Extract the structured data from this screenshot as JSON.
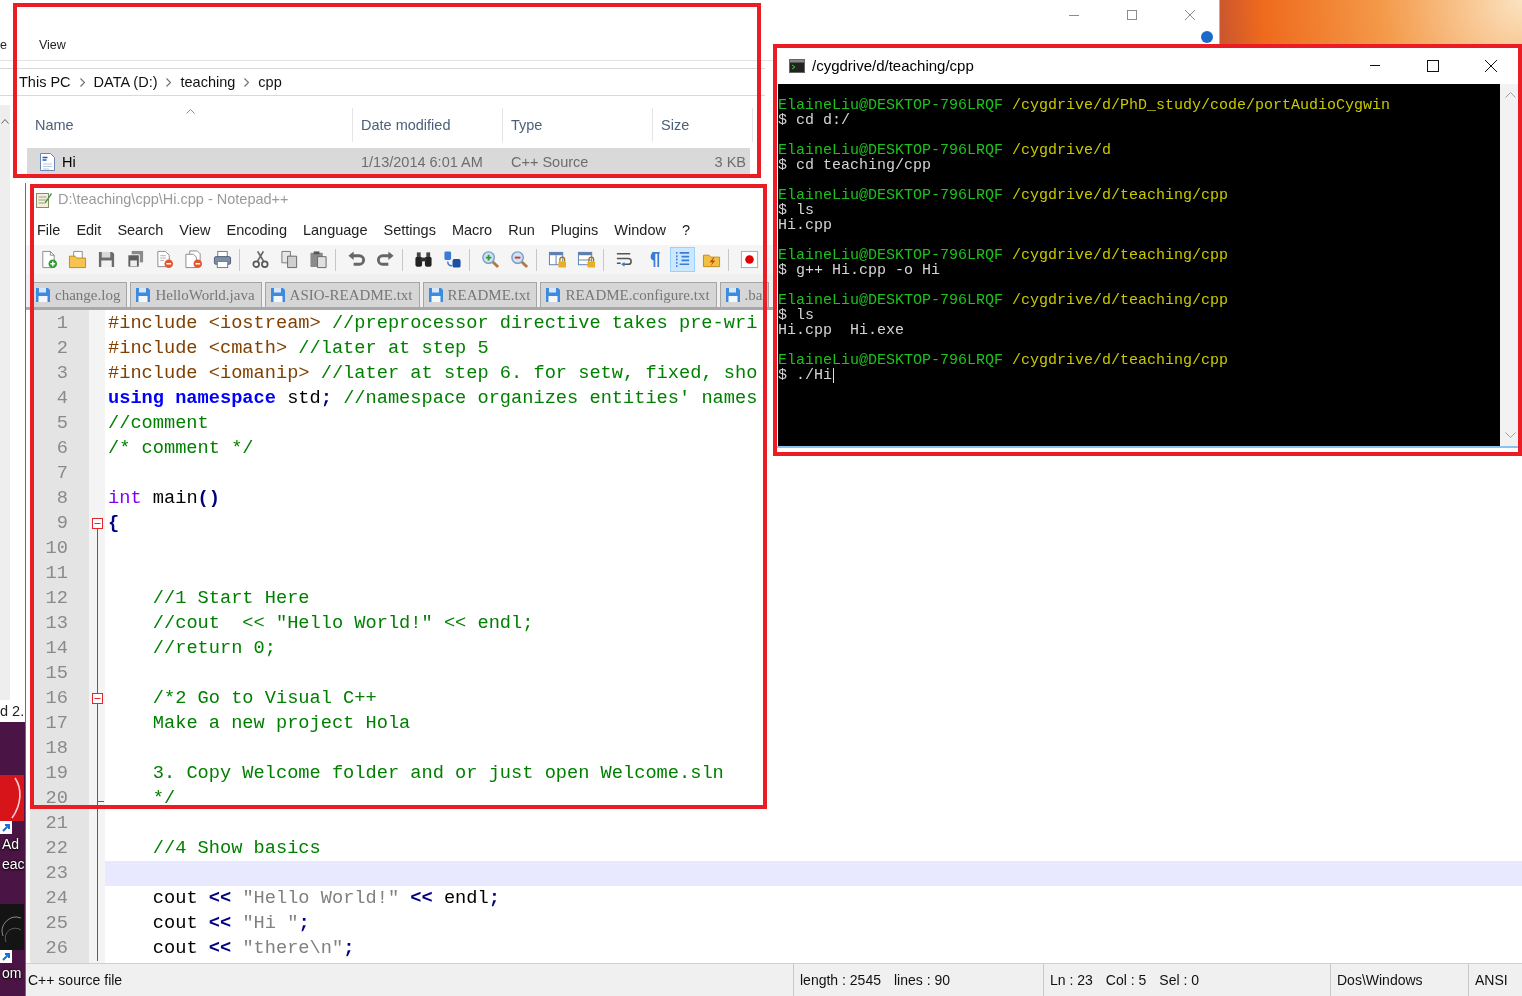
{
  "desktop": {
    "icons": [
      {
        "kind": "reader",
        "label": [
          "Ad",
          "eac"
        ]
      },
      {
        "kind": "prompt",
        "label": [
          "om"
        ]
      }
    ]
  },
  "explorer": {
    "highlighted": true,
    "ribbon_tabs": [
      "e",
      "View"
    ],
    "breadcrumb": [
      "This PC",
      "DATA (D:)",
      "teaching",
      "cpp"
    ],
    "columns": [
      {
        "label": "Name",
        "sorted": true
      },
      {
        "label": "Date modified",
        "sorted": false
      },
      {
        "label": "Type",
        "sorted": false
      },
      {
        "label": "Size",
        "sorted": false
      }
    ],
    "files": [
      {
        "name": "Hi",
        "date_modified": "1/13/2014 6:01 AM",
        "type": "C++ Source",
        "size": "3 KB",
        "selected": true
      }
    ],
    "status_text": "d 2."
  },
  "notepad": {
    "highlighted": true,
    "title": "D:\\teaching\\cpp\\Hi.cpp - Notepad++",
    "menu": [
      "File",
      "Edit",
      "Search",
      "View",
      "Encoding",
      "Language",
      "Settings",
      "Macro",
      "Run",
      "Plugins",
      "Window",
      "?"
    ],
    "toolbar": [
      [
        {
          "kind": "new",
          "pressed": false
        },
        {
          "kind": "open",
          "pressed": false
        },
        {
          "kind": "save",
          "pressed": false
        },
        {
          "kind": "save_all",
          "pressed": false
        },
        {
          "kind": "close",
          "pressed": false
        },
        {
          "kind": "close_all",
          "pressed": false
        },
        {
          "kind": "print",
          "pressed": false
        }
      ],
      [
        {
          "kind": "cut",
          "pressed": false
        },
        {
          "kind": "copy",
          "pressed": false
        },
        {
          "kind": "paste",
          "pressed": false
        }
      ],
      [
        {
          "kind": "undo",
          "pressed": false
        },
        {
          "kind": "redo",
          "pressed": false
        }
      ],
      [
        {
          "kind": "find",
          "pressed": false
        },
        {
          "kind": "replace",
          "pressed": false
        }
      ],
      [
        {
          "kind": "zoom_in",
          "pressed": false
        },
        {
          "kind": "zoom_out",
          "pressed": false
        }
      ],
      [
        {
          "kind": "sync_v",
          "pressed": false
        },
        {
          "kind": "sync_h",
          "pressed": false
        }
      ],
      [
        {
          "kind": "wrap",
          "pressed": false
        },
        {
          "kind": "all_chars",
          "pressed": false
        },
        {
          "kind": "indent_guide",
          "pressed": true
        },
        {
          "kind": "udl",
          "pressed": false
        }
      ],
      [
        {
          "kind": "record",
          "pressed": false
        }
      ]
    ],
    "tabs": [
      {
        "label": "change.log",
        "selected": false
      },
      {
        "label": "HelloWorld.java",
        "selected": false
      },
      {
        "label": "ASIO-README.txt",
        "selected": false
      },
      {
        "label": "README.txt",
        "selected": false
      },
      {
        "label": "README.configure.txt",
        "selected": false
      },
      {
        "label": ".ba",
        "selected": false
      }
    ],
    "lines": [
      {
        "number": "1",
        "kind": "line",
        "current": false,
        "segments": [
          {
            "kind": "preprocessor",
            "text": "#include <iostream>"
          },
          {
            "kind": "comment",
            "text": " //preprocessor directive takes pre-wri"
          }
        ]
      },
      {
        "number": "2",
        "kind": "line",
        "current": false,
        "segments": [
          {
            "kind": "preprocessor",
            "text": "#include <cmath>"
          },
          {
            "kind": "comment",
            "text": " //later at step 5"
          }
        ]
      },
      {
        "number": "3",
        "kind": "line",
        "current": false,
        "segments": [
          {
            "kind": "preprocessor",
            "text": "#include <iomanip>"
          },
          {
            "kind": "comment",
            "text": " //later at step 6. for setw, fixed, sho"
          }
        ]
      },
      {
        "number": "4",
        "kind": "line",
        "current": false,
        "segments": [
          {
            "kind": "keyword",
            "text": "using namespace"
          },
          {
            "kind": "plain",
            "text": " std"
          },
          {
            "kind": "operator",
            "text": ";"
          },
          {
            "kind": "comment",
            "text": " //namespace organizes entities' names"
          }
        ]
      },
      {
        "number": "5",
        "kind": "line",
        "current": false,
        "segments": [
          {
            "kind": "comment",
            "text": "//comment"
          }
        ]
      },
      {
        "number": "6",
        "kind": "line",
        "current": false,
        "segments": [
          {
            "kind": "comment",
            "text": "/* comment */"
          }
        ]
      },
      {
        "number": "7",
        "kind": "line",
        "current": false
      },
      {
        "number": "8",
        "kind": "line",
        "current": false,
        "segments": [
          {
            "kind": "type",
            "text": "int"
          },
          {
            "kind": "plain",
            "text": " main"
          },
          {
            "kind": "operator",
            "text": "()"
          }
        ]
      },
      {
        "number": "9",
        "kind": "foldstart",
        "current": false,
        "segments": [
          {
            "kind": "operator",
            "text": "{"
          }
        ]
      },
      {
        "number": "10",
        "kind": "line",
        "current": false
      },
      {
        "number": "11",
        "kind": "line",
        "current": false
      },
      {
        "number": "12",
        "kind": "line",
        "current": false,
        "segments": [
          {
            "kind": "comment",
            "text": "    //1 Start Here"
          }
        ]
      },
      {
        "number": "13",
        "kind": "line",
        "current": false,
        "segments": [
          {
            "kind": "comment",
            "text": "    //cout  << \"Hello World!\" << endl;"
          }
        ]
      },
      {
        "number": "14",
        "kind": "line",
        "current": false,
        "segments": [
          {
            "kind": "comment",
            "text": "    //return 0;"
          }
        ]
      },
      {
        "number": "15",
        "kind": "line",
        "current": false
      },
      {
        "number": "16",
        "kind": "foldstart",
        "current": false,
        "segments": [
          {
            "kind": "comment",
            "text": "    /*2 Go to Visual C++"
          }
        ]
      },
      {
        "number": "17",
        "kind": "line",
        "current": false,
        "segments": [
          {
            "kind": "comment",
            "text": "    Make a new project Hola"
          }
        ]
      },
      {
        "number": "18",
        "kind": "line",
        "current": false
      },
      {
        "number": "19",
        "kind": "line",
        "current": false,
        "segments": [
          {
            "kind": "comment",
            "text": "    3. Copy Welcome folder and or just open Welcome.sln"
          }
        ]
      },
      {
        "number": "20",
        "kind": "foldend",
        "current": false,
        "segments": [
          {
            "kind": "comment",
            "text": "    */"
          }
        ]
      },
      {
        "number": "21",
        "kind": "line",
        "current": false
      },
      {
        "number": "22",
        "kind": "line",
        "current": false,
        "segments": [
          {
            "kind": "comment",
            "text": "    //4 Show basics"
          }
        ]
      },
      {
        "number": "23",
        "kind": "line",
        "current": true
      },
      {
        "number": "24",
        "kind": "line",
        "current": false,
        "segments": [
          {
            "kind": "plain",
            "text": "    cout "
          },
          {
            "kind": "operator",
            "text": "<<"
          },
          {
            "kind": "string",
            "text": " \"Hello World!\""
          },
          {
            "kind": "operator",
            "text": " <<"
          },
          {
            "kind": "plain",
            "text": " endl"
          },
          {
            "kind": "operator",
            "text": ";"
          }
        ]
      },
      {
        "number": "25",
        "kind": "line",
        "current": false,
        "segments": [
          {
            "kind": "plain",
            "text": "    cout "
          },
          {
            "kind": "operator",
            "text": "<<"
          },
          {
            "kind": "string",
            "text": " \"Hi \""
          },
          {
            "kind": "operator",
            "text": ";"
          }
        ]
      },
      {
        "number": "26",
        "kind": "line",
        "current": false,
        "segments": [
          {
            "kind": "plain",
            "text": "    cout "
          },
          {
            "kind": "operator",
            "text": "<<"
          },
          {
            "kind": "string",
            "text": " \"there\\n\""
          },
          {
            "kind": "operator",
            "text": ";"
          }
        ]
      }
    ],
    "status": {
      "file_type": "C++ source file",
      "length": "length : 2545",
      "line_count": "lines : 90",
      "ln": "Ln : 23",
      "col": "Col : 5",
      "sel": "Sel : 0",
      "eol": "Dos\\Windows",
      "encoding": "ANSI"
    }
  },
  "terminal": {
    "highlighted": true,
    "title": "/cygdrive/d/teaching/cpp",
    "sessions": [
      {
        "user": "ElaineLiu@DESKTOP-796LRQF",
        "path": "/cygdrive/d/PhD_study/code/portAudioCygwin",
        "command": "$ cd d:/",
        "cursor": false
      },
      {
        "user": "ElaineLiu@DESKTOP-796LRQF",
        "path": "/cygdrive/d",
        "command": "$ cd teaching/cpp",
        "cursor": false
      },
      {
        "user": "ElaineLiu@DESKTOP-796LRQF",
        "path": "/cygdrive/d/teaching/cpp",
        "command": "$ ls",
        "output": "Hi.cpp",
        "cursor": false
      },
      {
        "user": "ElaineLiu@DESKTOP-796LRQF",
        "path": "/cygdrive/d/teaching/cpp",
        "command": "$ g++ Hi.cpp -o Hi",
        "cursor": false
      },
      {
        "user": "ElaineLiu@DESKTOP-796LRQF",
        "path": "/cygdrive/d/teaching/cpp",
        "command": "$ ls",
        "output": "Hi.cpp  Hi.exe",
        "cursor": false
      },
      {
        "user": "ElaineLiu@DESKTOP-796LRQF",
        "path": "/cygdrive/d/teaching/cpp",
        "command": "$ ./Hi",
        "cursor": true
      }
    ]
  }
}
